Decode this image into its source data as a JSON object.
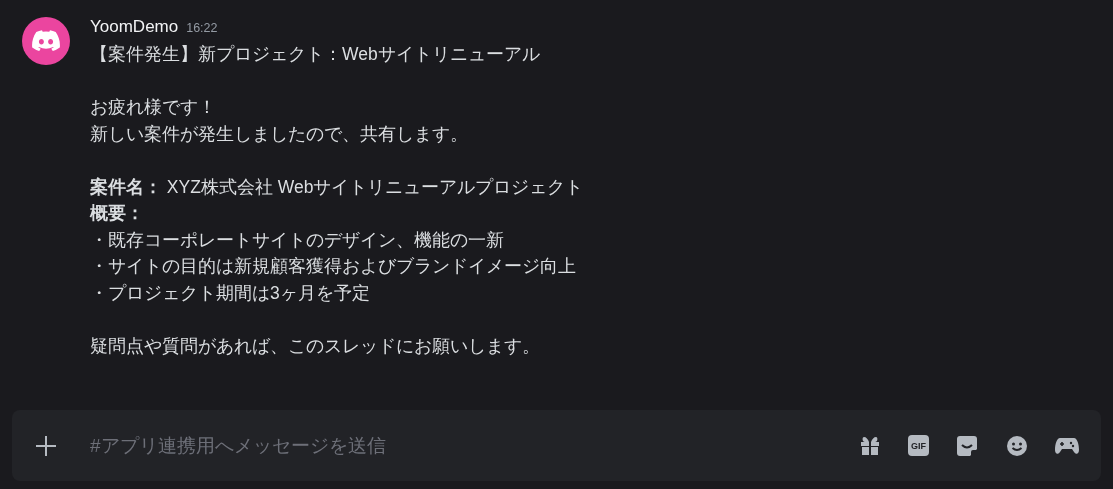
{
  "message": {
    "author": "YoomDemo",
    "time": "16:22",
    "paragraphs": [
      {
        "lines": [
          {
            "text": "【案件発生】新プロジェクト：Webサイトリニューアル",
            "bold": false
          }
        ]
      },
      {
        "lines": [
          {
            "text": "お疲れ様です！",
            "bold": false
          },
          {
            "text": "新しい案件が発生しましたので、共有します。",
            "bold": false
          }
        ]
      },
      {
        "lines": [
          {
            "text": "**案件名：** XYZ株式会社 Webサイトリニューアルプロジェクト",
            "bold": false
          },
          {
            "text": "概要：",
            "bold": true
          },
          {
            "text": "・既存コーポレートサイトのデザイン、機能の一新",
            "bold": false
          },
          {
            "text": "・サイトの目的は新規顧客獲得およびブランドイメージ向上",
            "bold": false
          },
          {
            "text": "・プロジェクト期間は3ヶ月を予定",
            "bold": false
          }
        ]
      },
      {
        "lines": [
          {
            "text": "疑問点や質問があれば、このスレッドにお願いします。",
            "bold": false
          }
        ]
      }
    ]
  },
  "composer": {
    "placeholder": "#アプリ連携用へメッセージを送信",
    "gif_label": "GIF"
  }
}
